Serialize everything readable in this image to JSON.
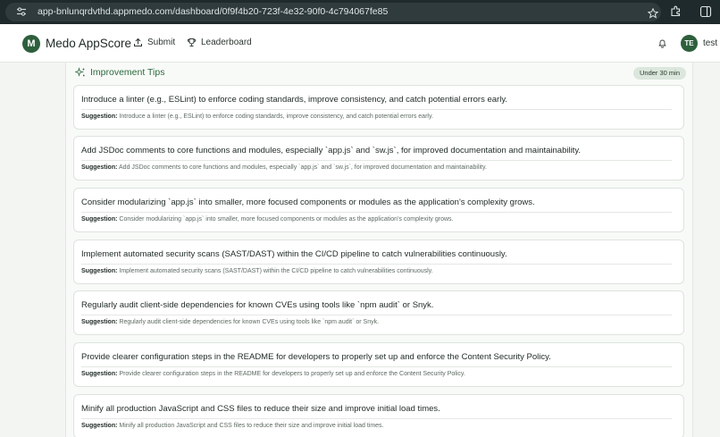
{
  "browser": {
    "url": "app-bnlunqrdvthd.appmedo.com/dashboard/0f9f4b20-723f-4e32-90f0-4c794067fe85"
  },
  "header": {
    "logo_letter": "M",
    "brand": "Medo AppScore",
    "nav": {
      "submit": "Submit",
      "leaderboard": "Leaderboard"
    },
    "user": {
      "initials": "TE",
      "name": "test"
    }
  },
  "tips": {
    "title": "Improvement Tips",
    "badge": "Under 30 min",
    "suggestion_label": "Suggestion:",
    "items": [
      {
        "title": "Introduce a linter (e.g., ESLint) to enforce coding standards, improve consistency, and catch potential errors early.",
        "suggestion": "Introduce a linter (e.g., ESLint) to enforce coding standards, improve consistency, and catch potential errors early."
      },
      {
        "title": "Add JSDoc comments to core functions and modules, especially `app.js` and `sw.js`, for improved documentation and maintainability.",
        "suggestion": "Add JSDoc comments to core functions and modules, especially `app.js` and `sw.js`, for improved documentation and maintainability."
      },
      {
        "title": "Consider modularizing `app.js` into smaller, more focused components or modules as the application's complexity grows.",
        "suggestion": "Consider modularizing `app.js` into smaller, more focused components or modules as the application's complexity grows."
      },
      {
        "title": "Implement automated security scans (SAST/DAST) within the CI/CD pipeline to catch vulnerabilities continuously.",
        "suggestion": "Implement automated security scans (SAST/DAST) within the CI/CD pipeline to catch vulnerabilities continuously."
      },
      {
        "title": "Regularly audit client-side dependencies for known CVEs using tools like `npm audit` or Snyk.",
        "suggestion": "Regularly audit client-side dependencies for known CVEs using tools like `npm audit` or Snyk."
      },
      {
        "title": "Provide clearer configuration steps in the README for developers to properly set up and enforce the Content Security Policy.",
        "suggestion": "Provide clearer configuration steps in the README for developers to properly set up and enforce the Content Security Policy."
      },
      {
        "title": "Minify all production JavaScript and CSS files to reduce their size and improve initial load times.",
        "suggestion": "Minify all production JavaScript and CSS files to reduce their size and improve initial load times."
      }
    ]
  }
}
